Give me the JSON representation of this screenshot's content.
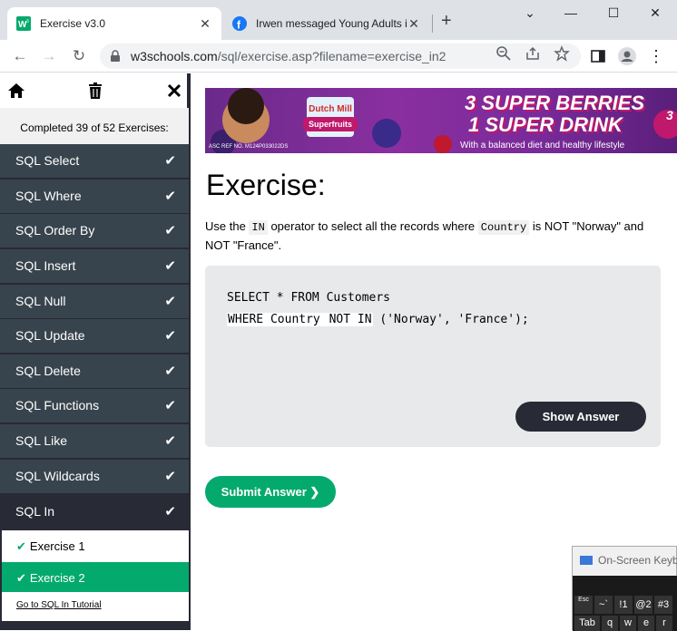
{
  "browser": {
    "tabs": [
      {
        "title": "Exercise v3.0",
        "favicon": "w3schools-icon",
        "active": true
      },
      {
        "title": "Irwen messaged Young Adults in...",
        "favicon": "facebook-icon",
        "active": false
      }
    ],
    "url_host": "w3schools.com",
    "url_path": "/sql/exercise.asp?filename=exercise_in2",
    "window_controls": [
      "minimize-icon",
      "maximize-icon",
      "close-icon"
    ]
  },
  "sidebar": {
    "completed": "Completed 39 of 52 Exercises:",
    "sections": [
      {
        "label": "SQL Select"
      },
      {
        "label": "SQL Where"
      },
      {
        "label": "SQL Order By"
      },
      {
        "label": "SQL Insert"
      },
      {
        "label": "SQL Null"
      },
      {
        "label": "SQL Update"
      },
      {
        "label": "SQL Delete"
      },
      {
        "label": "SQL Functions"
      },
      {
        "label": "SQL Like"
      },
      {
        "label": "SQL Wildcards"
      },
      {
        "label": "SQL In"
      }
    ],
    "subitems": [
      {
        "label": "Exercise 1"
      },
      {
        "label": "Exercise 2"
      }
    ],
    "goto": "Go to SQL In Tutorial"
  },
  "banner": {
    "line1": "3 SUPER BERRIES",
    "line2": "1 SUPER DRINK",
    "line3": "With a balanced diet and healthy lifestyle",
    "ref": "ASC REF NO. M124P033022DS",
    "brand": "Dutch Mill",
    "brand_sub": "Superfruits",
    "partial_text": "3"
  },
  "main": {
    "heading": "Exercise:",
    "instr_1": "Use the ",
    "instr_code1": "IN",
    "instr_2": " operator to select all the records where ",
    "instr_code2": "Country",
    "instr_3": " is NOT \"Norway\" and NOT \"France\".",
    "code_line1": "SELECT * FROM Customers",
    "code_line2_pre": "WHERE Country ",
    "code_input": "NOT IN",
    "code_line2_post": " ('Norway', 'France');",
    "show_answer": "Show Answer",
    "submit": "Submit Answer ❯"
  },
  "osk": {
    "title": "On-Screen Keyb",
    "row1": [
      "Esc",
      "~`",
      "!1",
      "@2",
      "#3"
    ],
    "row2": [
      "Tab",
      "q",
      "w",
      "e",
      "r"
    ]
  },
  "colors": {
    "accent_green": "#04aa6d",
    "sidebar_dark": "#282a35",
    "sidebar_item": "#38444d"
  }
}
